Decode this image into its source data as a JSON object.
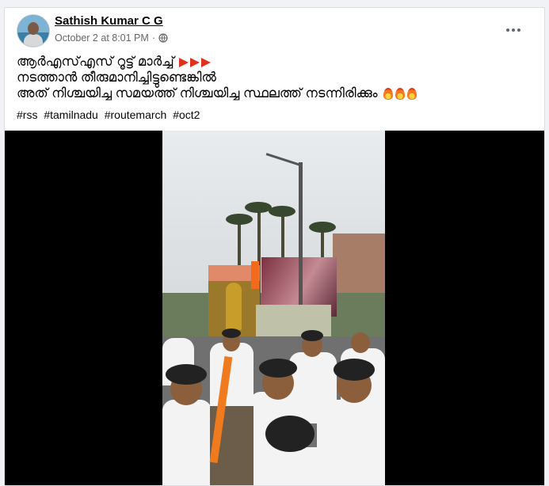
{
  "post": {
    "author": "Sathish Kumar C G",
    "timestamp": "October 2 at 8:01 PM",
    "separator": "·",
    "lines": [
      "ആർഎസ്എസ്  റൂട്ട് മാർച്ച്",
      "നടത്താൻ തീരുമാനിച്ചിട്ടുണ്ടെങ്കിൽ",
      "അത് നിശ്ചയിച്ച സമയത്ത് നിശ്ചയിച്ച സ്ഥലത്ത് നടന്നിരിക്കും"
    ],
    "hashtags": [
      "#rss",
      "#tamilnadu",
      "#routemarch",
      "#oct2"
    ]
  },
  "icons": {
    "privacy": "globe-icon",
    "menu": "more-options-icon",
    "emoji_line1": "red-triangle-icon",
    "emoji_line3": "fire-icon"
  },
  "colors": {
    "accent_triangle": "#e0301e",
    "video_background": "#000000",
    "meta_text": "#65676b"
  }
}
